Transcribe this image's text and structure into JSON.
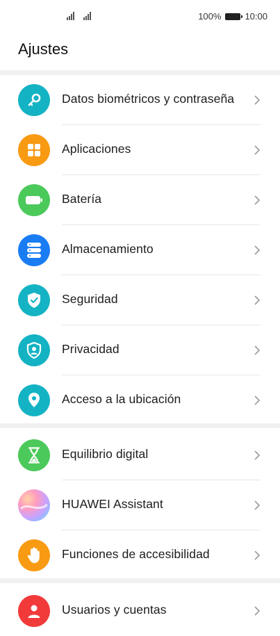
{
  "status": {
    "battery_percent": "100%",
    "time": "10:00"
  },
  "header": {
    "title": "Ajustes"
  },
  "colors": {
    "teal": "#14b3c4",
    "orange": "#f89a12",
    "green": "#4bc95a",
    "blue": "#1a7cf3",
    "red": "#f23a3a",
    "divider": "#f1f1f1"
  },
  "group1": [
    {
      "label": "Datos biométricos y contraseña",
      "icon": "key-icon"
    },
    {
      "label": "Aplicaciones",
      "icon": "apps-grid-icon"
    },
    {
      "label": "Batería",
      "icon": "battery-icon"
    },
    {
      "label": "Almacenamiento",
      "icon": "storage-icon"
    },
    {
      "label": "Seguridad",
      "icon": "shield-check-icon"
    },
    {
      "label": "Privacidad",
      "icon": "privacy-shield-icon"
    },
    {
      "label": "Acceso a la ubicación",
      "icon": "location-pin-icon"
    }
  ],
  "group2": [
    {
      "label": "Equilibrio digital",
      "icon": "hourglass-icon"
    },
    {
      "label": "HUAWEI Assistant",
      "icon": "huawei-assistant-icon"
    },
    {
      "label": "Funciones de accesibilidad",
      "icon": "hand-icon"
    }
  ],
  "group3": [
    {
      "label": "Usuarios y cuentas",
      "icon": "user-icon"
    }
  ]
}
